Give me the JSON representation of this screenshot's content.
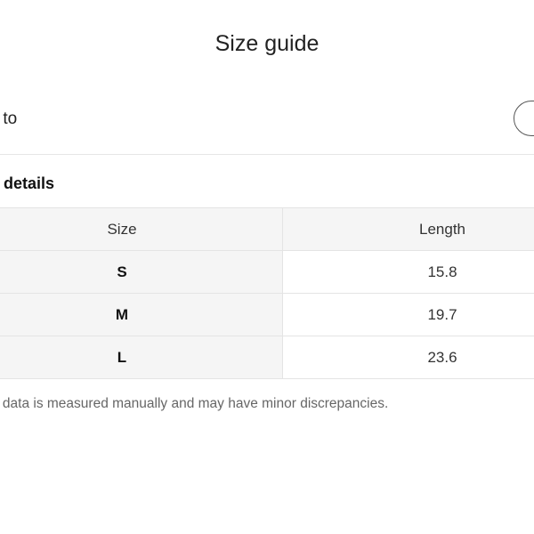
{
  "dialog": {
    "title": "Size guide"
  },
  "unit_switch": {
    "label": "ch to"
  },
  "product_details": {
    "heading": "uct details",
    "table": {
      "headers": [
        "Size",
        "Length"
      ],
      "rows": [
        {
          "size": "S",
          "length": "15.8"
        },
        {
          "size": "M",
          "length": "19.7"
        },
        {
          "size": "L",
          "length": "23.6"
        }
      ]
    },
    "note": "e data is measured manually and may have minor discrepancies."
  }
}
